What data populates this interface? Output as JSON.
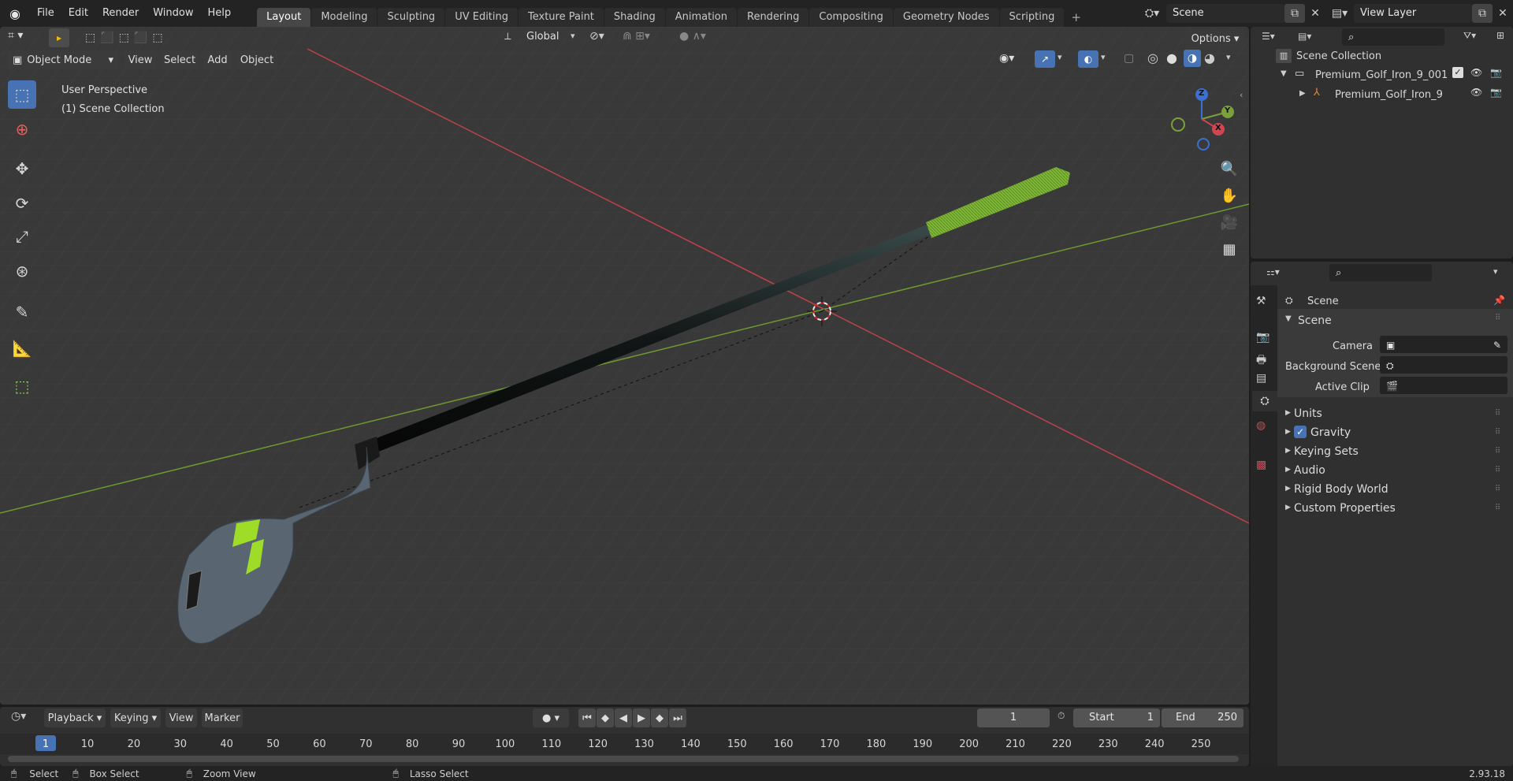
{
  "menu": [
    "File",
    "Edit",
    "Render",
    "Window",
    "Help"
  ],
  "workspaces": [
    "Layout",
    "Modeling",
    "Sculpting",
    "UV Editing",
    "Texture Paint",
    "Shading",
    "Animation",
    "Rendering",
    "Compositing",
    "Geometry Nodes",
    "Scripting"
  ],
  "active_workspace": "Layout",
  "scene_name": "Scene",
  "view_layer": "View Layer",
  "viewport": {
    "mode": "Object Mode",
    "menus": [
      "View",
      "Select",
      "Add",
      "Object"
    ],
    "orientation": "Global",
    "options": "Options",
    "perspective_label": "User Perspective",
    "collection_label": "(1) Scene Collection",
    "gizmo_axes": {
      "x": "X",
      "y": "Y",
      "z": "Z"
    }
  },
  "outliner": {
    "root": "Scene Collection",
    "items": [
      {
        "name": "Premium_Golf_Iron_9_001",
        "level": 1
      },
      {
        "name": "Premium_Golf_Iron_9",
        "level": 2
      }
    ]
  },
  "properties": {
    "context_title": "Scene",
    "section": "Scene",
    "camera_label": "Camera",
    "background_scene_label": "Background Scene",
    "active_clip_label": "Active Clip",
    "subsections": [
      "Units",
      "Gravity",
      "Keying Sets",
      "Audio",
      "Rigid Body World",
      "Custom Properties"
    ],
    "gravity_checked": true
  },
  "timeline": {
    "menus": [
      "Playback",
      "Keying",
      "View",
      "Marker"
    ],
    "current_frame": "1",
    "start_label": "Start",
    "start": "1",
    "end_label": "End",
    "end": "250",
    "ticks": [
      "1",
      "10",
      "20",
      "30",
      "40",
      "50",
      "60",
      "70",
      "80",
      "90",
      "100",
      "110",
      "120",
      "130",
      "140",
      "150",
      "160",
      "170",
      "180",
      "190",
      "200",
      "210",
      "220",
      "230",
      "240",
      "250"
    ]
  },
  "statusbar": {
    "select": "Select",
    "box_select": "Box Select",
    "zoom_view": "Zoom View",
    "lasso_select": "Lasso Select",
    "version": "2.93.18"
  },
  "colors": {
    "accent": "#4772b3",
    "x_axis": "#d0454f",
    "y_axis": "#7aa03a",
    "grip_green": "#86c03a"
  }
}
